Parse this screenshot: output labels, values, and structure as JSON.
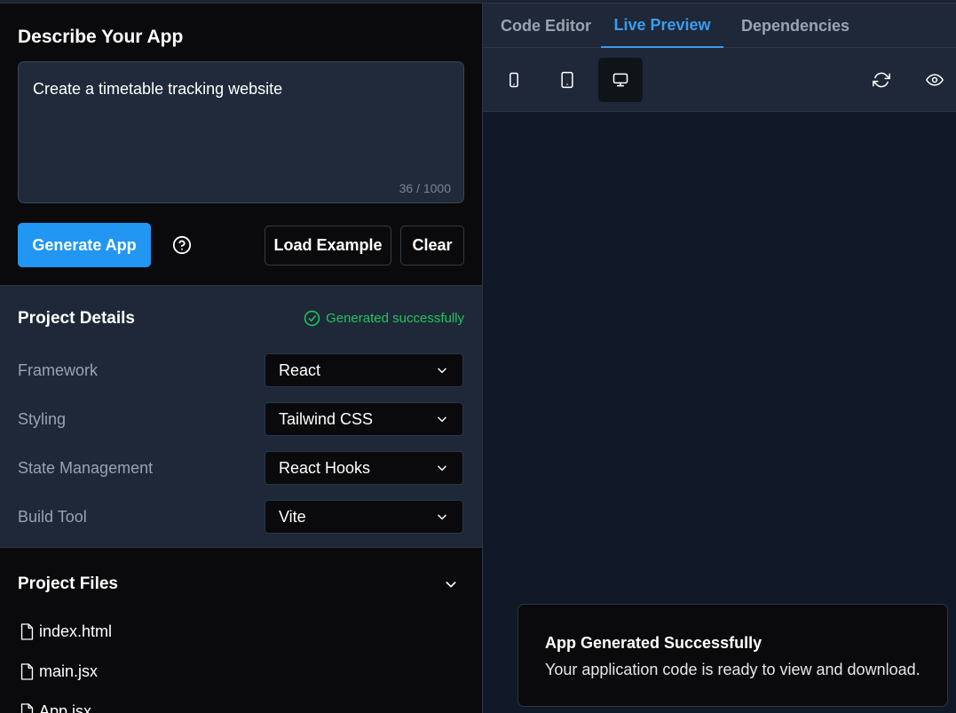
{
  "describe": {
    "title": "Describe Your App",
    "prompt_value": "Create a timetable tracking website",
    "char_count": "36 / 1000",
    "generate_label": "Generate App",
    "load_example_label": "Load Example",
    "clear_label": "Clear"
  },
  "details": {
    "title": "Project Details",
    "status": "Generated successfully",
    "rows": [
      {
        "label": "Framework",
        "value": "React"
      },
      {
        "label": "Styling",
        "value": "Tailwind CSS"
      },
      {
        "label": "State Management",
        "value": "React Hooks"
      },
      {
        "label": "Build Tool",
        "value": "Vite"
      }
    ]
  },
  "files": {
    "title": "Project Files",
    "items": [
      "index.html",
      "main.jsx",
      "App.jsx"
    ]
  },
  "tabs": {
    "code_editor": "Code Editor",
    "live_preview": "Live Preview",
    "dependencies": "Dependencies",
    "active": "Live Preview"
  },
  "toolbar": {
    "icons": [
      "mobile-icon",
      "tablet-icon",
      "desktop-icon",
      "refresh-icon",
      "eye-icon"
    ],
    "active_viewport": "desktop"
  },
  "toast": {
    "title": "App Generated Successfully",
    "message": "Your application code is ready to view and download."
  },
  "colors": {
    "accent": "#2196f3",
    "success": "#22c55e",
    "tab_active": "#3b9bf0",
    "panel": "#1e2838",
    "background": "#0a0a0c"
  }
}
